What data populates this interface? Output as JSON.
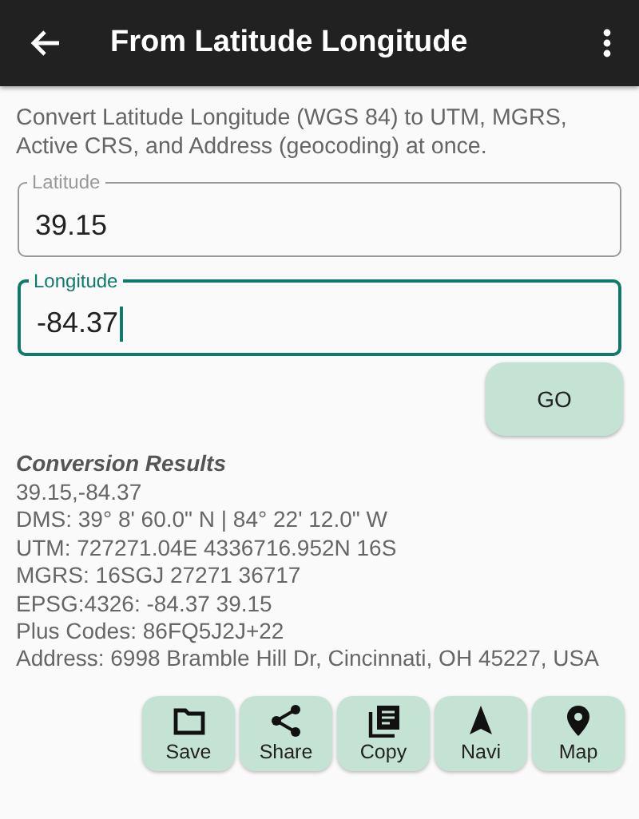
{
  "app_bar": {
    "title": "From Latitude Longitude"
  },
  "description": "Convert Latitude Longitude (WGS 84) to UTM, MGRS, Active CRS, and Address (geocoding) at once.",
  "fields": [
    {
      "label": "Latitude",
      "value": "39.15",
      "focused": false
    },
    {
      "label": "Longitude",
      "value": "-84.37",
      "focused": true
    }
  ],
  "go_button": "GO",
  "results": {
    "heading": "Conversion Results",
    "lines": [
      "39.15,-84.37",
      "DMS: 39° 8' 60.0\" N | 84° 22' 12.0\" W",
      "UTM: 727271.04E 4336716.952N 16S",
      "MGRS: 16SGJ 27271 36717",
      "EPSG:4326: -84.37 39.15",
      "Plus Codes: 86FQ5J2J+22",
      "Address: 6998 Bramble Hill Dr, Cincinnati, OH 45227, USA"
    ]
  },
  "actions": [
    "Save",
    "Share",
    "Copy",
    "Navi",
    "Map"
  ]
}
